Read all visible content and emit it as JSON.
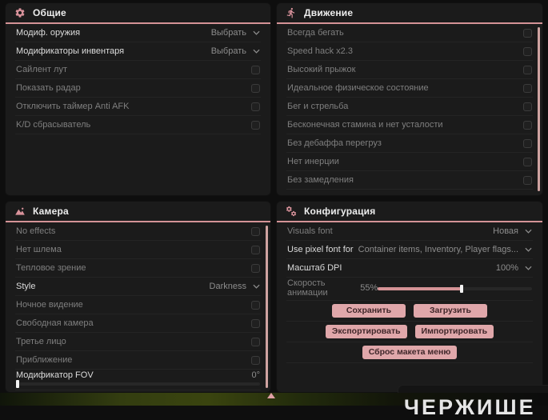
{
  "colors": {
    "accent": "#d49396",
    "button_bg": "#e0a7aa",
    "button_text": "#3f2629",
    "scrollbar": "#cfa3a1",
    "panel_bg": "#1b1b1b"
  },
  "watermark": "ЧЕРЖИШЕ",
  "panels": [
    {
      "id": "general",
      "title": "Общие",
      "icon": "gear-icon",
      "rows": [
        {
          "label": "Модиф. оружия",
          "bright": true,
          "control": "select",
          "value": "Выбрать"
        },
        {
          "label": "Модификаторы инвентаря",
          "bright": true,
          "control": "select",
          "value": "Выбрать"
        },
        {
          "label": "Сайлент лут",
          "control": "checkbox"
        },
        {
          "label": "Показать радар",
          "control": "checkbox"
        },
        {
          "label": "Отключить таймер Anti AFK",
          "control": "checkbox"
        },
        {
          "label": "K/D сбрасыватель",
          "control": "checkbox"
        }
      ]
    },
    {
      "id": "movement",
      "title": "Движение",
      "icon": "runner-icon",
      "scrollbar": true,
      "rows": [
        {
          "label": "Всегда бегать",
          "control": "checkbox"
        },
        {
          "label": "Speed hack x2.3",
          "control": "checkbox"
        },
        {
          "label": "Высокий прыжок",
          "control": "checkbox"
        },
        {
          "label": "Идеальное физическое состояние",
          "control": "checkbox"
        },
        {
          "label": "Бег и стрельба",
          "control": "checkbox"
        },
        {
          "label": "Бесконечная стамина и нет усталости",
          "control": "checkbox"
        },
        {
          "label": "Без дебаффа перегруз",
          "control": "checkbox"
        },
        {
          "label": "Нет инерции",
          "control": "checkbox"
        },
        {
          "label": "Без замедления",
          "control": "checkbox"
        }
      ]
    },
    {
      "id": "camera",
      "title": "Камера",
      "icon": "image-icon",
      "scrollbar": true,
      "rows": [
        {
          "label": "No effects",
          "control": "checkbox"
        },
        {
          "label": "Нет шлема",
          "control": "checkbox"
        },
        {
          "label": "Тепловое зрение",
          "control": "checkbox"
        },
        {
          "label": "Style",
          "bright": true,
          "control": "select",
          "value": "Darkness"
        },
        {
          "label": "Ночное видение",
          "control": "checkbox"
        },
        {
          "label": "Свободная камера",
          "control": "checkbox"
        },
        {
          "label": "Третье лицо",
          "control": "checkbox"
        },
        {
          "label": "Приближение",
          "control": "checkbox"
        },
        {
          "label": "Модификатор FOV",
          "bright": true,
          "control": "slider",
          "value": "0°",
          "percent": 0,
          "track_width_pct": 100
        }
      ]
    },
    {
      "id": "config",
      "title": "Конфигурация",
      "icon": "gears-icon",
      "rows": [
        {
          "label": "Visuals font",
          "control": "select",
          "value": "Новая"
        },
        {
          "label": "Use pixel font for",
          "bright": true,
          "control": "select",
          "value": "Container items, Inventory, Player flags..."
        },
        {
          "label": "Масштаб DPI",
          "bright": true,
          "control": "select",
          "value": "100%"
        },
        {
          "label": "Скорость анимации",
          "control": "slider",
          "value": "55%",
          "percent": 55,
          "track_width_pct": 63
        }
      ],
      "button_rows": [
        [
          {
            "label": "Сохранить",
            "name": "save-button"
          },
          {
            "label": "Загрузить",
            "name": "load-button"
          }
        ],
        [
          {
            "label": "Экспортировать",
            "name": "export-button"
          },
          {
            "label": "Импортировать",
            "name": "import-button"
          }
        ],
        [
          {
            "label": "Сброс макета меню",
            "name": "reset-menu-layout-button"
          }
        ]
      ]
    }
  ]
}
